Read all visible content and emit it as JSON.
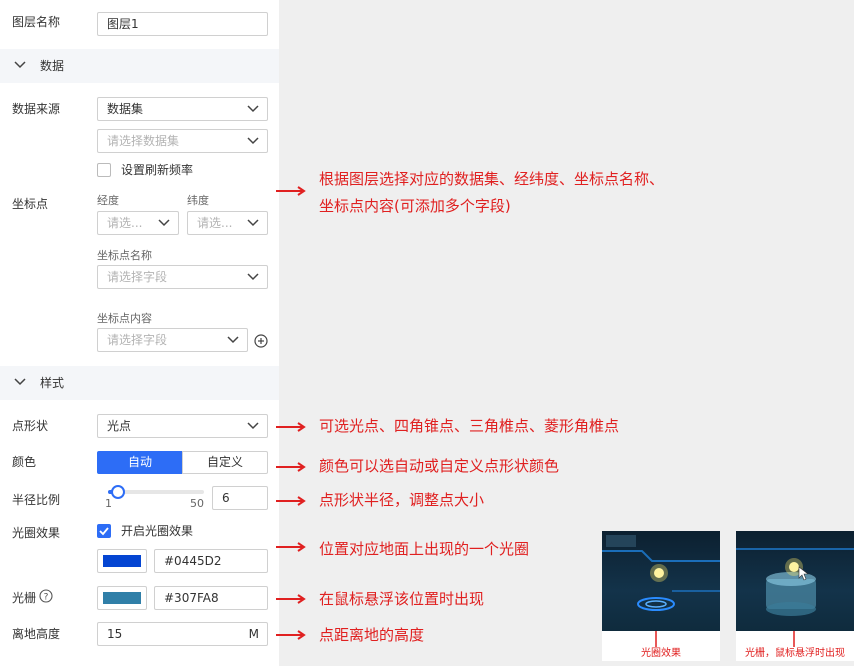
{
  "colors": {
    "accent": "#2d6df6",
    "note_red": "#e02020",
    "halo_color": "#0445D2",
    "grid_color": "#307FA8"
  },
  "layer": {
    "label": "图层名称",
    "value": "图层1"
  },
  "sections": {
    "data": "数据",
    "style": "样式"
  },
  "data_source": {
    "label": "数据来源",
    "value": "数据集",
    "dataset_placeholder": "请选择数据集",
    "refresh_label": "设置刷新频率"
  },
  "coords": {
    "label": "坐标点",
    "lng_label": "经度",
    "lng_placeholder": "请选...",
    "lat_label": "纬度",
    "lat_placeholder": "请选...",
    "name_label": "坐标点名称",
    "name_placeholder": "请选择字段",
    "content_label": "坐标点内容",
    "content_placeholder": "请选择字段"
  },
  "shape": {
    "label": "点形状",
    "value": "光点"
  },
  "color": {
    "label": "颜色",
    "auto": "自动",
    "custom": "自定义"
  },
  "radius": {
    "label": "半径比例",
    "min": "1",
    "max": "50",
    "value": "6",
    "slider_fraction": 0.1
  },
  "halo": {
    "label": "光圈效果",
    "enable_label": "开启光圈效果",
    "enabled": true,
    "color_text": "#0445D2"
  },
  "grid": {
    "label": "光栅",
    "color_text": "#307FA8"
  },
  "height": {
    "label": "离地高度",
    "value": "15",
    "unit": "M"
  },
  "notes": {
    "n1a": "根据图层选择对应的数据集、经纬度、坐标点名称、",
    "n1b": "坐标点内容(可添加多个字段)",
    "n2": "可选光点、四角锥点、三角椎点、菱形角椎点",
    "n3": "颜色可以选自动或自定义点形状颜色",
    "n4": "点形状半径，调整点大小",
    "n5": "位置对应地面上出现的一个光圈",
    "n6": "在鼠标悬浮该位置时出现",
    "n7": "点距离地的高度"
  },
  "thumbs": {
    "left_caption": "光圈效果",
    "right_caption": "光栅，鼠标悬浮时出现"
  }
}
